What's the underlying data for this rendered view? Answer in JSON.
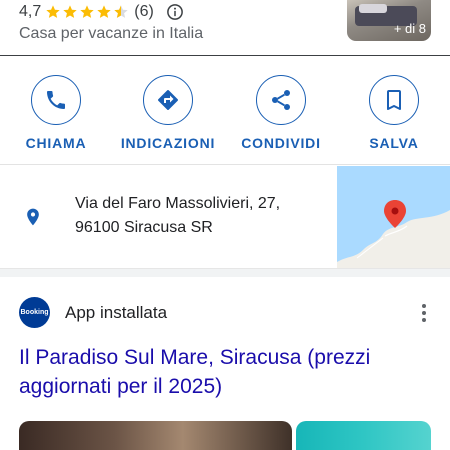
{
  "header": {
    "rating": "4,7",
    "stars": 4.5,
    "review_count": "(6)",
    "category": "Casa per vacanze in Italia",
    "photo_count": "+ di 8"
  },
  "actions": [
    {
      "label": "CHIAMA",
      "icon": "phone-icon"
    },
    {
      "label": "INDICAZIONI",
      "icon": "directions-icon"
    },
    {
      "label": "CONDIVIDI",
      "icon": "share-icon"
    },
    {
      "label": "SALVA",
      "icon": "bookmark-icon"
    }
  ],
  "address": {
    "line1": "Via del Faro Massolivieri, 27,",
    "line2": "96100 Siracusa SR"
  },
  "result": {
    "app_logo_text": "Booking",
    "app_label": "App installata",
    "title": "Il Paradiso Sul Mare, Siracusa (prezzi aggiornati per il 2025)"
  },
  "colors": {
    "accent": "#1a5fb4",
    "link": "#1a0dab",
    "star": "#fbbc04",
    "map_pin": "#ea4335"
  }
}
